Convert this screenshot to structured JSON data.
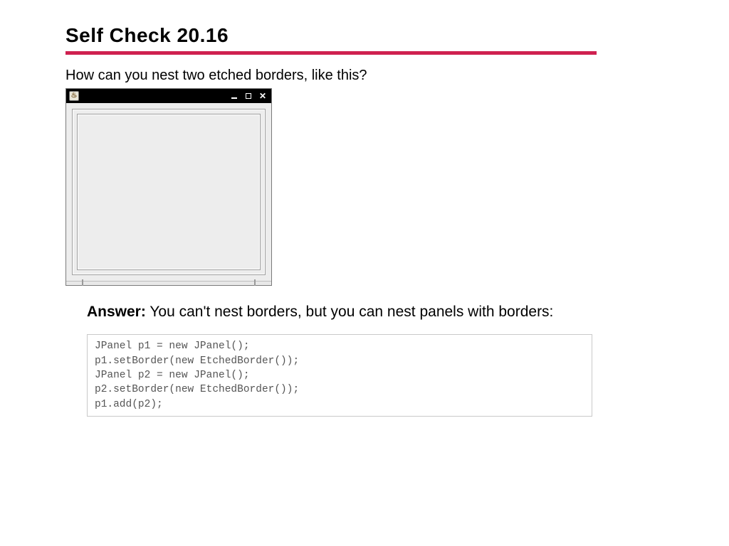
{
  "title": "Self Check 20.16",
  "question": "How can you nest two etched borders, like this?",
  "answer_label": "Answer:",
  "answer_text": " You can't nest borders, but you can nest panels with borders:",
  "code": "JPanel p1 = new JPanel();\np1.setBorder(new EtchedBorder());\nJPanel p2 = new JPanel();\np2.setBorder(new EtchedBorder());\np1.add(p2);",
  "window": {
    "icon_glyph": "♨",
    "close_glyph": "✕"
  }
}
